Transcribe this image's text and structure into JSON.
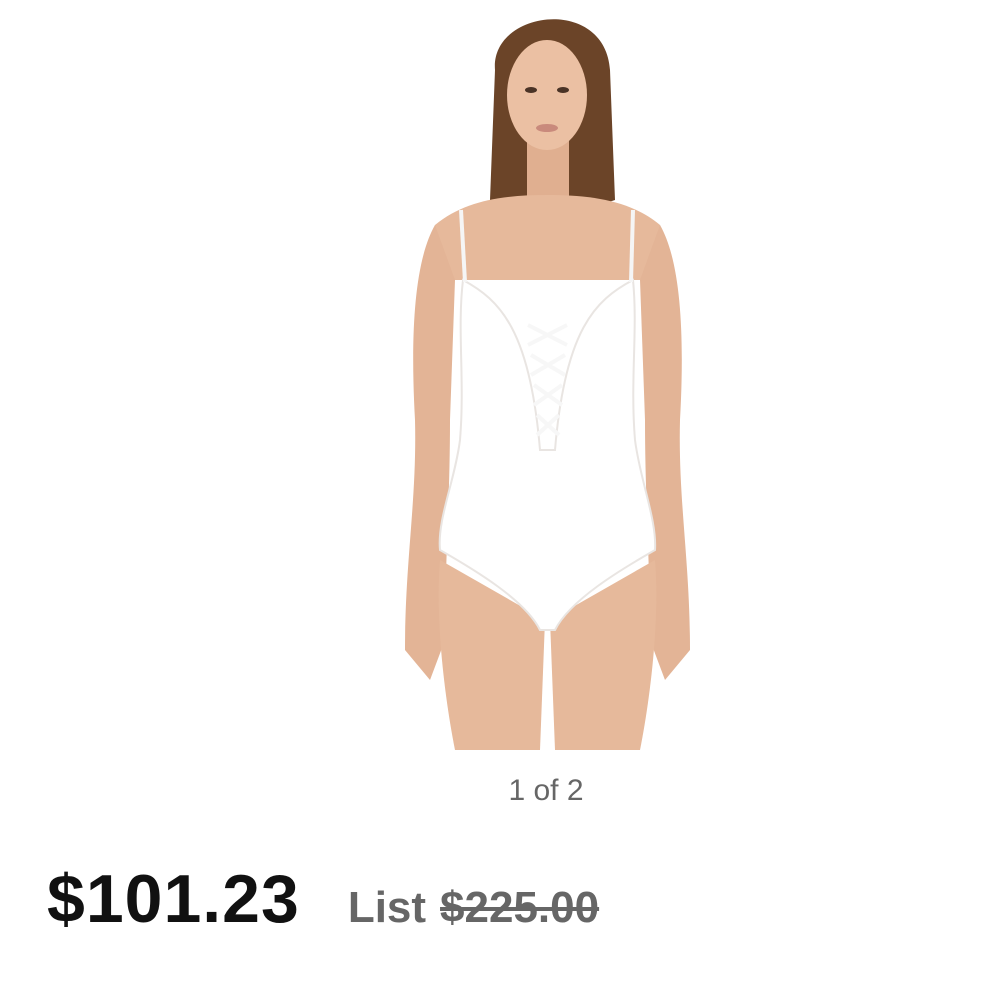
{
  "product": {
    "image_counter": "1 of 2",
    "sale_price": "$101.23",
    "list_label": "List",
    "list_price": "$225.00"
  },
  "colors": {
    "skin": "#e6b99b",
    "swimsuit": "#ffffff",
    "hair": "#6b4428",
    "price_text": "#111111",
    "muted_text": "#666666"
  }
}
